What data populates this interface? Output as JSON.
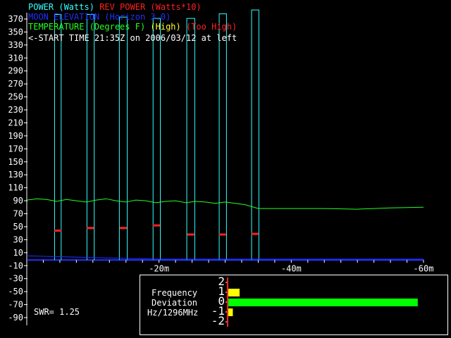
{
  "legend": {
    "line1": [
      {
        "text": "POWER (Watts)",
        "color": "#33ffff"
      },
      {
        "text": " ",
        "color": "#ffffff"
      },
      {
        "text": "REV POWER (Watts*10)",
        "color": "#ff2020"
      }
    ],
    "line2": [
      {
        "text": "MOON ELEVATION (Horizon 3.0)",
        "color": "#2030ff"
      }
    ],
    "line3": [
      {
        "text": "TEMPERATURE (Degrees F)",
        "color": "#22ff22"
      },
      {
        "text": " (High)",
        "color": "#ffff33"
      },
      {
        "text": " (Too High)",
        "color": "#ff2020"
      }
    ],
    "line4": [
      {
        "text": "<-START TIME 21:35Z on 2006/03/12 at left",
        "color": "#ffffff"
      }
    ]
  },
  "swr_text": "SWR= 1.25",
  "freq_panel": {
    "labels": [
      "Frequency",
      "Deviation",
      "Hz/1296MHz"
    ],
    "ticks": [
      "2",
      "1",
      "0",
      "-1",
      "-2"
    ],
    "bars": [
      {
        "row": "1",
        "value": 0.25,
        "color": "#ffff00"
      },
      {
        "row": "0",
        "value": 4.2,
        "color": "#00ff00"
      },
      {
        "row": "-1",
        "value": 0.1,
        "color": "#ffff00"
      }
    ]
  },
  "chart_data": {
    "type": "line",
    "title": "",
    "xlabel": "",
    "ylabel": "",
    "ylim": [
      -90,
      380
    ],
    "xlim": [
      0,
      -60
    ],
    "y_ticks": [
      370,
      350,
      330,
      310,
      290,
      270,
      250,
      230,
      210,
      190,
      170,
      150,
      130,
      110,
      90,
      70,
      50,
      30,
      10,
      -10,
      -30,
      -50,
      -70,
      -90
    ],
    "x_tick_labels": [
      {
        "value": -20,
        "label": "-20m"
      },
      {
        "value": -40,
        "label": "-40m"
      },
      {
        "value": -60,
        "label": "-60m"
      }
    ],
    "series": [
      {
        "name": "POWER (Watts)",
        "color": "#33ffff",
        "style": "pulses",
        "pulses": [
          {
            "x0": -4.2,
            "x1": -5.2,
            "value": 377
          },
          {
            "x0": -9.1,
            "x1": -10.2,
            "value": 377
          },
          {
            "x0": -14.0,
            "x1": -15.2,
            "value": 373
          },
          {
            "x0": -19.1,
            "x1": -20.2,
            "value": 371
          },
          {
            "x0": -24.2,
            "x1": -25.4,
            "value": 371
          },
          {
            "x0": -29.1,
            "x1": -30.2,
            "value": 378
          },
          {
            "x0": -34.0,
            "x1": -35.1,
            "value": 384
          }
        ]
      },
      {
        "name": "REV POWER (Watts*10)",
        "color": "#ff2020",
        "style": "dashes",
        "points": [
          {
            "x": -4.7,
            "y": 44
          },
          {
            "x": -9.6,
            "y": 48
          },
          {
            "x": -14.6,
            "y": 48
          },
          {
            "x": -19.6,
            "y": 52
          },
          {
            "x": -24.8,
            "y": 38
          },
          {
            "x": -29.6,
            "y": 38
          },
          {
            "x": -34.5,
            "y": 39
          }
        ]
      },
      {
        "name": "MOON ELEVATION (Horizon 3.0)",
        "color": "#2030ff",
        "style": "line",
        "points": [
          {
            "x": 0,
            "y": 5
          },
          {
            "x": -4.3,
            "y": 4
          },
          {
            "x": -8,
            "y": 3
          },
          {
            "x": -12,
            "y": 2
          },
          {
            "x": -16,
            "y": 1
          },
          {
            "x": -20,
            "y": 0
          },
          {
            "x": -40,
            "y": 0
          },
          {
            "x": -60,
            "y": 0
          }
        ]
      },
      {
        "name": "TEMPERATURE (Degrees F)",
        "color": "#22ff22",
        "style": "line",
        "points": [
          {
            "x": 0,
            "y": 91
          },
          {
            "x": -1.5,
            "y": 93
          },
          {
            "x": -3,
            "y": 92
          },
          {
            "x": -4.5,
            "y": 89
          },
          {
            "x": -6,
            "y": 92
          },
          {
            "x": -7.5,
            "y": 90
          },
          {
            "x": -9,
            "y": 88
          },
          {
            "x": -10.5,
            "y": 91
          },
          {
            "x": -12,
            "y": 93
          },
          {
            "x": -13.5,
            "y": 90
          },
          {
            "x": -15,
            "y": 88
          },
          {
            "x": -16.5,
            "y": 91
          },
          {
            "x": -18,
            "y": 90
          },
          {
            "x": -19.5,
            "y": 87
          },
          {
            "x": -21,
            "y": 89
          },
          {
            "x": -22.5,
            "y": 90
          },
          {
            "x": -24,
            "y": 87
          },
          {
            "x": -25.5,
            "y": 89
          },
          {
            "x": -27,
            "y": 88
          },
          {
            "x": -28.5,
            "y": 86
          },
          {
            "x": -30,
            "y": 88
          },
          {
            "x": -31.5,
            "y": 86
          },
          {
            "x": -33,
            "y": 84
          },
          {
            "x": -35,
            "y": 78
          },
          {
            "x": -40,
            "y": 78
          },
          {
            "x": -45,
            "y": 78
          },
          {
            "x": -50,
            "y": 77
          },
          {
            "x": -55,
            "y": 79
          },
          {
            "x": -60,
            "y": 80
          }
        ]
      }
    ],
    "grid": false,
    "legend_placement": "top-left"
  }
}
